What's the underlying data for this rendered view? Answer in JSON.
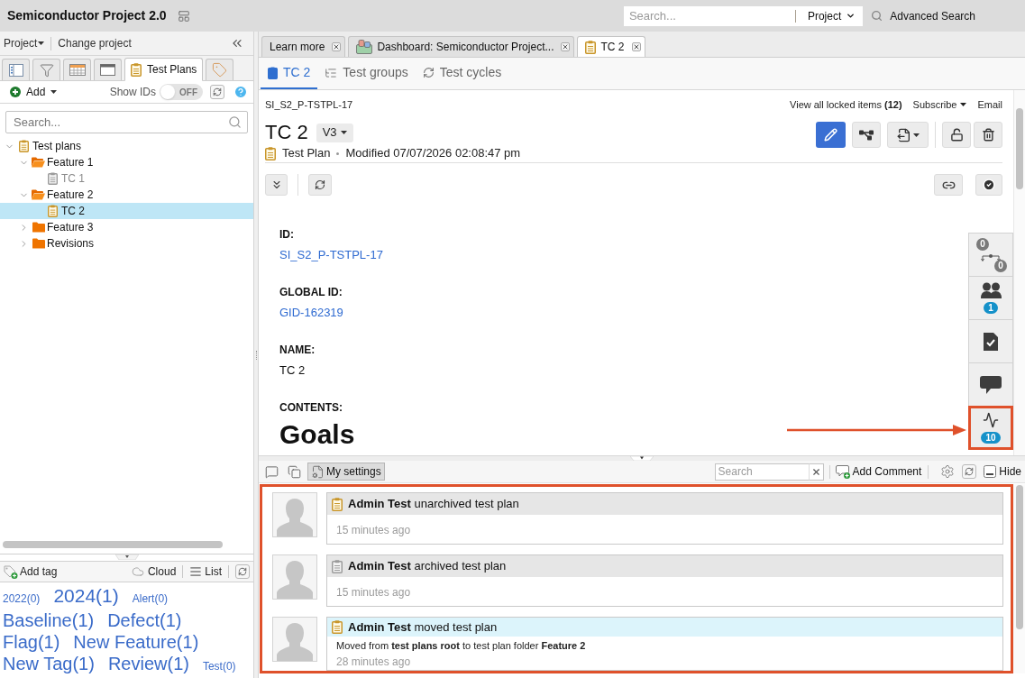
{
  "header": {
    "title": "Semiconductor Project 2.0",
    "search": {
      "placeholder": "Search...",
      "scope": "Project"
    },
    "advanced_search": "Advanced Search"
  },
  "project_bar": {
    "project_menu": "Project",
    "change_project": "Change project"
  },
  "sidebar_tabs": [
    {
      "selected": false
    },
    {
      "selected": false
    },
    {
      "selected": false
    },
    {
      "selected": false
    },
    {
      "label": "Test Plans",
      "selected": true
    },
    {
      "selected": false
    }
  ],
  "tree_toolbar": {
    "add": "Add",
    "show_ids": {
      "label": "Show IDs",
      "on": false,
      "state_text": "OFF"
    }
  },
  "tree_search": {
    "placeholder": "Search..."
  },
  "tree": [
    {
      "label": "Test plans",
      "kind": "plan",
      "archived": false,
      "expanded": true,
      "selected": false,
      "children": [
        {
          "label": "Feature 1",
          "kind": "folder",
          "expanded": true,
          "selected": false,
          "children": [
            {
              "label": "TC 1",
              "kind": "plan",
              "archived": true,
              "selected": false
            }
          ]
        },
        {
          "label": "Feature 2",
          "kind": "folder",
          "expanded": true,
          "selected": false,
          "children": [
            {
              "label": "TC 2",
              "kind": "plan",
              "archived": false,
              "selected": true
            }
          ]
        },
        {
          "label": "Feature 3",
          "kind": "folder",
          "expanded": false,
          "selected": false
        },
        {
          "label": "Revisions",
          "kind": "folder",
          "expanded": false,
          "selected": false
        }
      ]
    }
  ],
  "tags_toolbar": {
    "add_tag": "Add tag",
    "cloud": "Cloud",
    "list": "List"
  },
  "tags": [
    {
      "label": "2022(0)",
      "kind": "small"
    },
    {
      "label": "2024(1)",
      "kind": "large"
    },
    {
      "label": "Alert(0)",
      "kind": "small"
    },
    {
      "label": "Baseline(1)",
      "kind": "medium"
    },
    {
      "label": "Defect(1)",
      "kind": "medium"
    },
    {
      "label": "Flag(1)",
      "kind": "medium"
    },
    {
      "label": "New Feature(1)",
      "kind": "medium"
    },
    {
      "label": "New Tag(1)",
      "kind": "medium"
    },
    {
      "label": "Review(1)",
      "kind": "medium"
    },
    {
      "label": "Test(0)",
      "kind": "small"
    }
  ],
  "doc_tabs": [
    {
      "label": "Learn more",
      "kind": "page",
      "selected": false
    },
    {
      "label": "Dashboard: Semiconductor Project...",
      "kind": "dashboard",
      "selected": false
    },
    {
      "label": "TC 2",
      "kind": "plan",
      "selected": true
    }
  ],
  "item_tabs": [
    {
      "label": "TC 2",
      "selected": true
    },
    {
      "label": "Test groups",
      "selected": false
    },
    {
      "label": "Test cycles",
      "selected": false
    }
  ],
  "item": {
    "key": "SI_S2_P-TSTPL-17",
    "locked_items": "View all locked items **(12)**",
    "subscribe": "Subscribe",
    "email": "Email",
    "title": "TC 2",
    "version": "V3",
    "type": "Test Plan",
    "modified": "Modified 07/07/2026 02:08:47 pm"
  },
  "fields": [
    {
      "label": "ID:",
      "value": "SI_S2_P-TSTPL-17",
      "kind": "link"
    },
    {
      "label": "GLOBAL ID:",
      "value": "GID-162319",
      "kind": "link"
    },
    {
      "label": "NAME:",
      "value": "TC 2",
      "kind": "text"
    },
    {
      "label": "CONTENTS:",
      "value": "Goals",
      "kind": "heading"
    }
  ],
  "side_panel": [
    {
      "kind": "relations",
      "counts": [
        "0",
        "0"
      ],
      "highlighted": false
    },
    {
      "kind": "users",
      "badge": "1",
      "highlighted": false
    },
    {
      "kind": "review",
      "highlighted": false
    },
    {
      "kind": "comments",
      "highlighted": false
    },
    {
      "kind": "activity",
      "badge": "10",
      "highlighted": true
    }
  ],
  "activity_toolbar": {
    "settings": "My settings",
    "settings_pressed": true,
    "search": {
      "placeholder": "Search"
    },
    "add_comment": "Add Comment",
    "hide": "Hide"
  },
  "activity": {
    "highlighted": true,
    "items": [
      {
        "text": "**Admin Test** unarchived test plan",
        "time": "15 minutes ago",
        "archived": false,
        "selected": false
      },
      {
        "text": "**Admin Test** archived test plan",
        "time": "15 minutes ago",
        "archived": true,
        "selected": false
      },
      {
        "text": "**Admin Test** moved test plan",
        "detail": "Moved from **test plans root** to test plan folder **Feature 2**",
        "time": "28 minutes ago",
        "archived": false,
        "selected": true
      }
    ]
  }
}
